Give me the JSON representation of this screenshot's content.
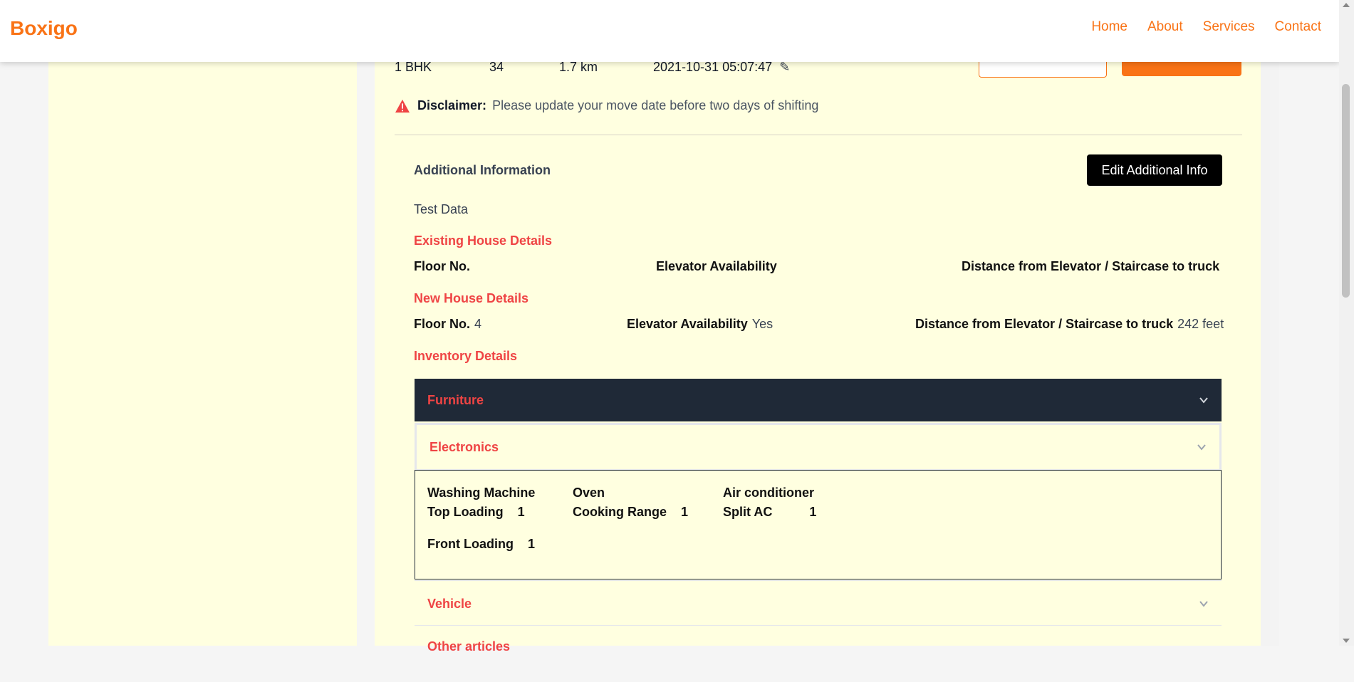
{
  "brand": "Boxigo",
  "nav": {
    "home": "Home",
    "about": "About",
    "services": "Services",
    "contact": "Contact"
  },
  "stats": {
    "property_size": "1 BHK",
    "total_items": "34",
    "distance": "1.7 km",
    "move_date": "2021-10-31 05:07:47"
  },
  "disclaimer": {
    "label": "Disclaimer:",
    "text": "Please update your move date before two days of shifting"
  },
  "additional": {
    "title": "Additional Information",
    "edit_button": "Edit Additional Info",
    "text": "Test Data"
  },
  "existing_house": {
    "title": "Existing House Details",
    "floor_label": "Floor No.",
    "floor_value": "",
    "elevator_label": "Elevator Availability",
    "elevator_value": "",
    "distance_label": "Distance from Elevator / Staircase to truck",
    "distance_value": ""
  },
  "new_house": {
    "title": "New House Details",
    "floor_label": "Floor No.",
    "floor_value": "4",
    "elevator_label": "Elevator Availability",
    "elevator_value": "Yes",
    "distance_label": "Distance from Elevator / Staircase to truck",
    "distance_value": "242 feet"
  },
  "inventory": {
    "title": "Inventory Details",
    "sections": {
      "furniture": "Furniture",
      "electronics": "Electronics",
      "vehicle": "Vehicle",
      "other": "Other articles"
    },
    "electronics": [
      {
        "name": "Washing Machine",
        "items": [
          {
            "type": "Top Loading",
            "qty": "1"
          },
          {
            "type": "Front Loading",
            "qty": "1"
          }
        ]
      },
      {
        "name": "Oven",
        "items": [
          {
            "type": "Cooking Range",
            "qty": "1"
          }
        ]
      },
      {
        "name": "Air conditioner",
        "items": [
          {
            "type": "Split AC",
            "qty": "1"
          }
        ]
      }
    ]
  },
  "colors": {
    "brand": "#f97316",
    "accent_red": "#ef4444",
    "card_bg": "#ffffe0",
    "dark_header": "#1f2937"
  },
  "icons": {
    "edit_date": "pencil-icon",
    "warning": "warning-icon",
    "expand": "chevron-down-icon"
  }
}
